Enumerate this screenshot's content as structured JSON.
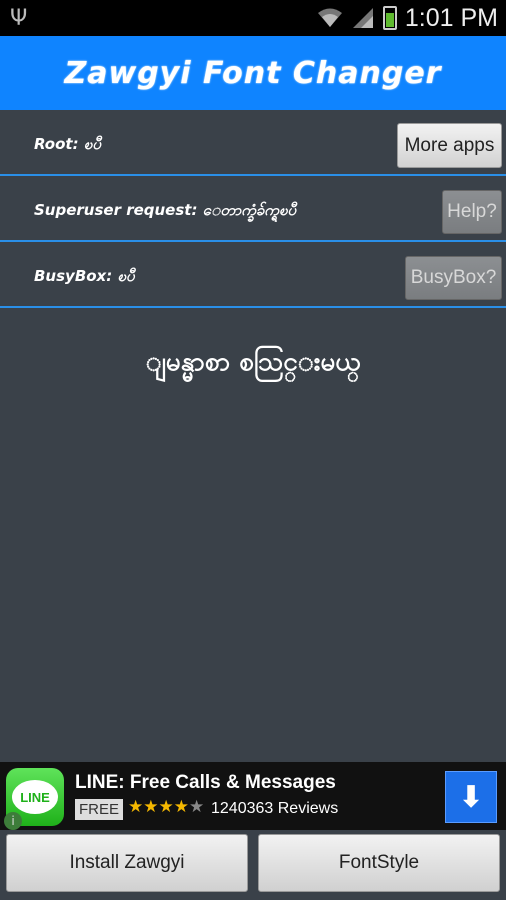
{
  "status_bar": {
    "time": "1:01 PM",
    "icons": [
      "usb-icon",
      "wifi-icon",
      "signal-icon",
      "battery-charging-icon"
    ]
  },
  "header": {
    "title": "Zawgyi Font Changer"
  },
  "rows": [
    {
      "label": "Root: ၿပီ",
      "button": "More apps"
    },
    {
      "label": "Superuser request: ေတာက္ခံခ်က္ရၿပီ",
      "button": "Help?"
    },
    {
      "label": "BusyBox: ၿပီ",
      "button": "BusyBox?"
    }
  ],
  "center_text": "ျမန္မာစာ စသြင္းမယ္",
  "ad": {
    "logo_text": "LINE",
    "title": "LINE: Free Calls & Messages",
    "badge": "FREE",
    "rating": 4,
    "reviews": "1240363 Reviews",
    "download_icon": "download-arrow-icon",
    "info_icon": "info-icon"
  },
  "bottom_buttons": {
    "install": "Install Zawgyi",
    "fontstyle": "FontStyle"
  },
  "colors": {
    "accent": "#0f84ff",
    "background": "#3a4149",
    "divider": "#2a8fe8"
  }
}
